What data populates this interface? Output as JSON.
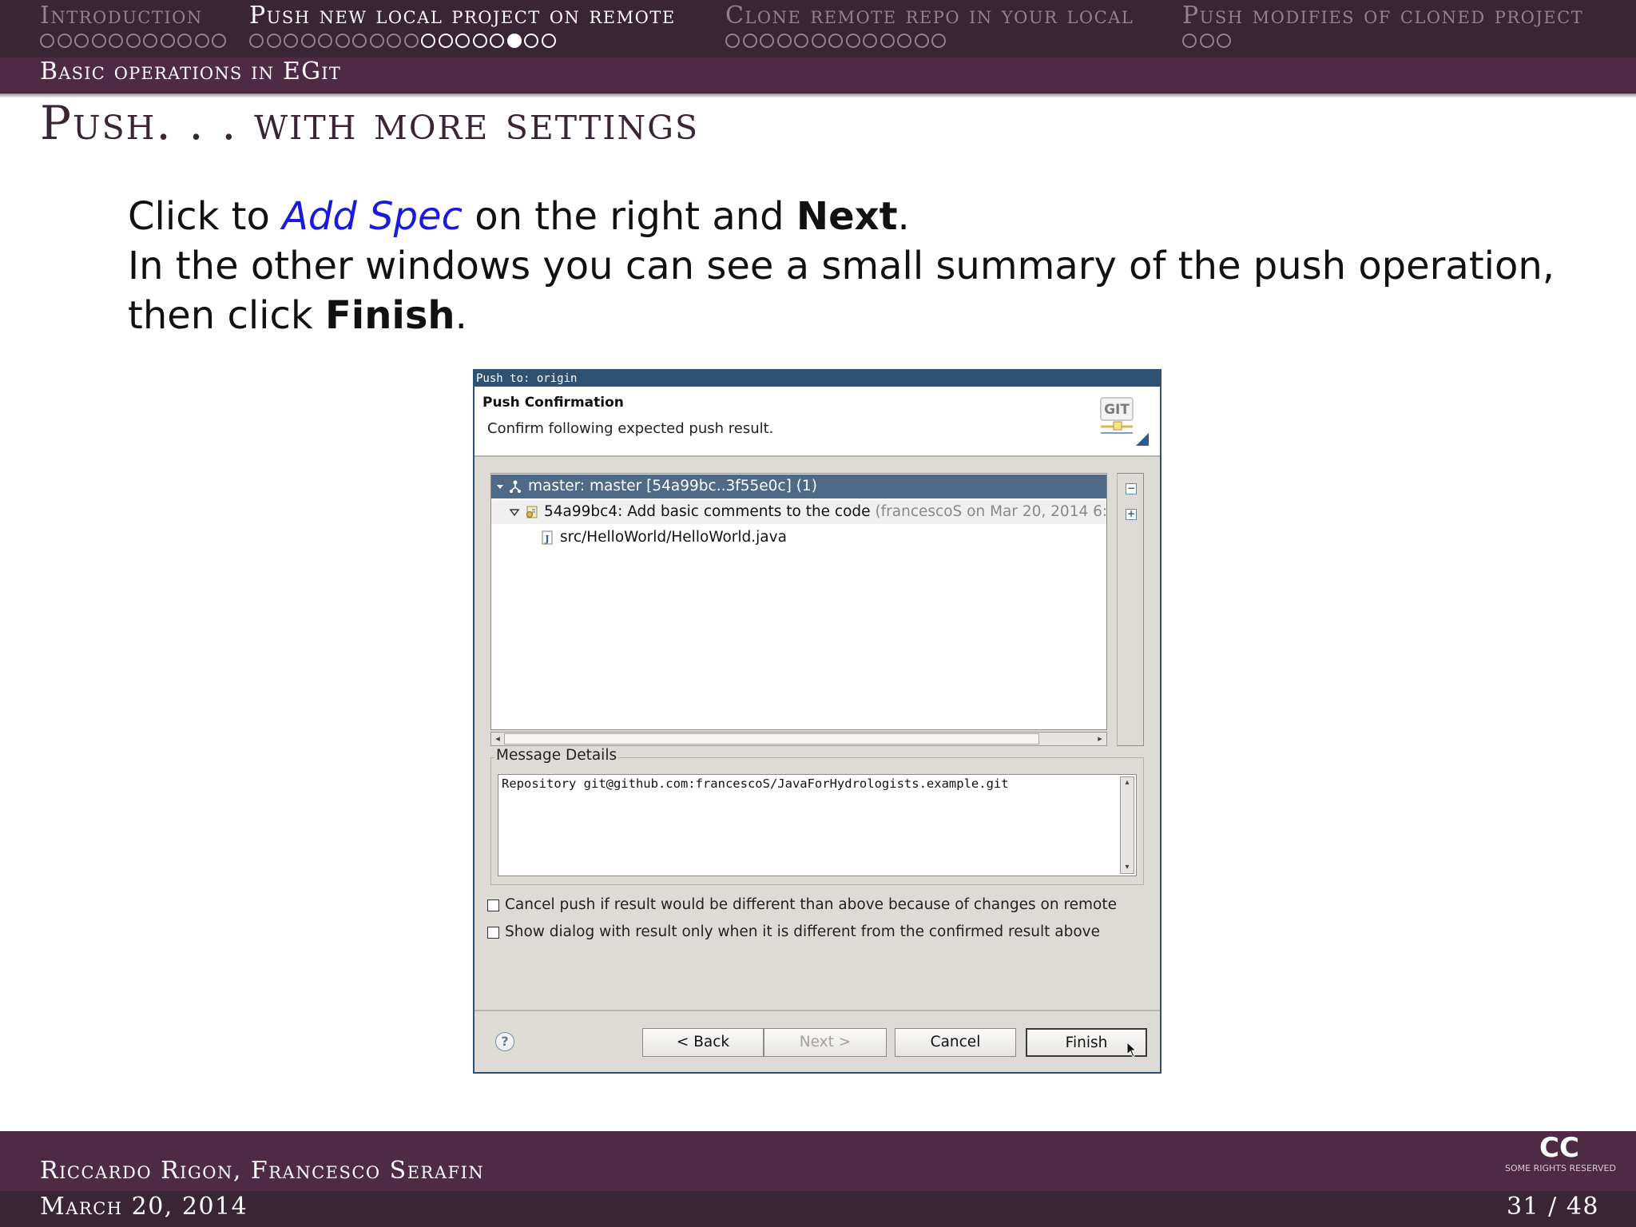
{
  "header": {
    "sections": [
      {
        "label": "Introduction",
        "dots": 11,
        "filled_index": -1,
        "active": false
      },
      {
        "label": "Push new local project on remote",
        "dots": 18,
        "filled_index": 15,
        "active": true
      },
      {
        "label": "Clone remote repo in your local",
        "dots": 13,
        "filled_index": -1,
        "active": false
      },
      {
        "label": "Push modifies of cloned project",
        "dots": 3,
        "filled_index": -1,
        "active": false
      }
    ],
    "subsection": "Basic operations in EGit"
  },
  "frame": {
    "title": "Push. . . with more settings"
  },
  "body": {
    "l1_pre": "Click to ",
    "l1_kw": "Add Spec",
    "l1_mid": " on the right and ",
    "l1_bold": "Next",
    "l1_end": ".",
    "l2_pre": "In the other windows you can see a small summary of the push operation, then click ",
    "l2_bold": "Finish",
    "l2_end": "."
  },
  "dialog": {
    "window_title": "Push to: origin",
    "banner_title": "Push Confirmation",
    "banner_message": "Confirm following expected push result.",
    "logo_text": "GIT",
    "tree": {
      "row1": "master: master [54a99bc..3f55e0c] (1)",
      "row2_main": "54a99bc4: Add basic comments to the code ",
      "row2_meta": "(francescoS on Mar 20, 2014 6:",
      "row3": "src/HelloWorld/HelloWorld.java"
    },
    "side_collapse": "−",
    "side_expand": "+",
    "message_details_label": "Message Details",
    "message_details_text": "Repository git@github.com:francescoS/JavaForHydrologists.example.git",
    "checkbox1": "Cancel push if result would be different than above because of changes on remote",
    "checkbox2": "Show dialog with result only when it is different from the confirmed result above",
    "help": "?",
    "buttons": {
      "back": "< Back",
      "next": "Next >",
      "cancel": "Cancel",
      "finish": "Finish"
    }
  },
  "footer": {
    "authors": "Riccardo Rigon, Francesco Serafin",
    "date": "March 20, 2014",
    "page": "31 / 48",
    "cc": "CC",
    "cc_sub": "SOME RIGHTS RESERVED"
  },
  "colors": {
    "header_bg": "#3a2535",
    "subheader_bg": "#4e2a44",
    "link_blue": "#1a1adc",
    "dialog_title_bg": "#2f5273",
    "selection_bg": "#4f6a89"
  }
}
